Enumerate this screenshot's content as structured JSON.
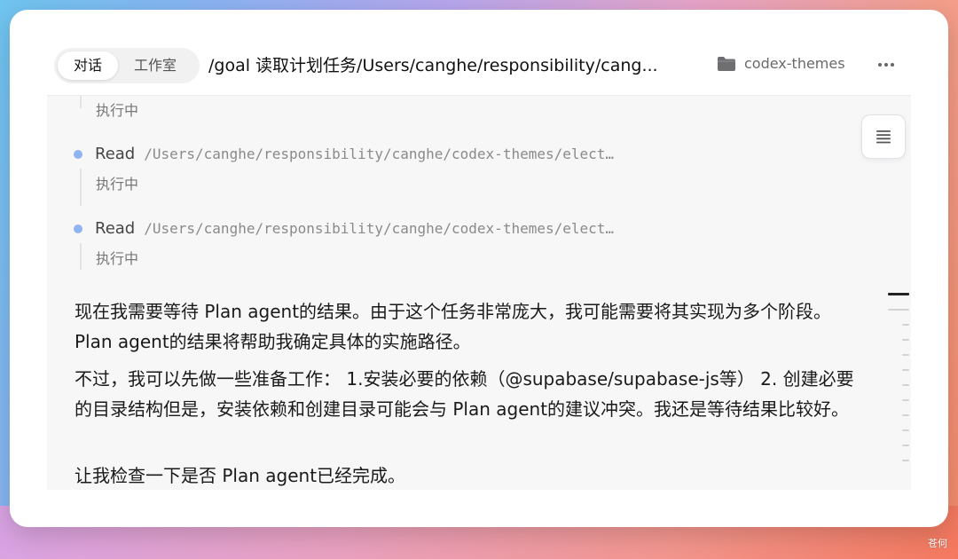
{
  "header": {
    "tabs": [
      {
        "label": "对话",
        "active": true
      },
      {
        "label": "工作室",
        "active": false
      }
    ],
    "title": "/goal 读取计划任务/Users/canghe/responsibility/cang...",
    "project_name": "codex-themes",
    "project_icon": "folder-icon",
    "more_icon": "more-horizontal-icon"
  },
  "steps": [
    {
      "label": "",
      "path": "",
      "status": "执行中"
    },
    {
      "label": "Read",
      "path": "/Users/canghe/responsibility/canghe/codex-themes/elect…",
      "status": "执行中"
    },
    {
      "label": "Read",
      "path": "/Users/canghe/responsibility/canghe/codex-themes/elect…",
      "status": "执行中"
    }
  ],
  "paragraphs": [
    "现在我需要等待 Plan agent的结果。由于这个任务非常庞大，我可能需要将其实现为多个阶段。Plan agent的结果将帮助我确定具体的实施路径。",
    "不过，我可以先做一些准备工作： 1.安装必要的依赖（@supabase/supabase-js等） 2. 创建必要的目录结构但是，安装依赖和创建目录可能会与 Plan agent的建议冲突。我还是等待结果比较好。",
    "让我检查一下是否 Plan agent已经完成。"
  ],
  "side": {
    "outline_icon": "list-icon"
  },
  "colors": {
    "step_dot": "#8fb4f2",
    "window_bg": "#ffffff",
    "content_bg": "#f7f7f8"
  },
  "watermark": "苍何"
}
